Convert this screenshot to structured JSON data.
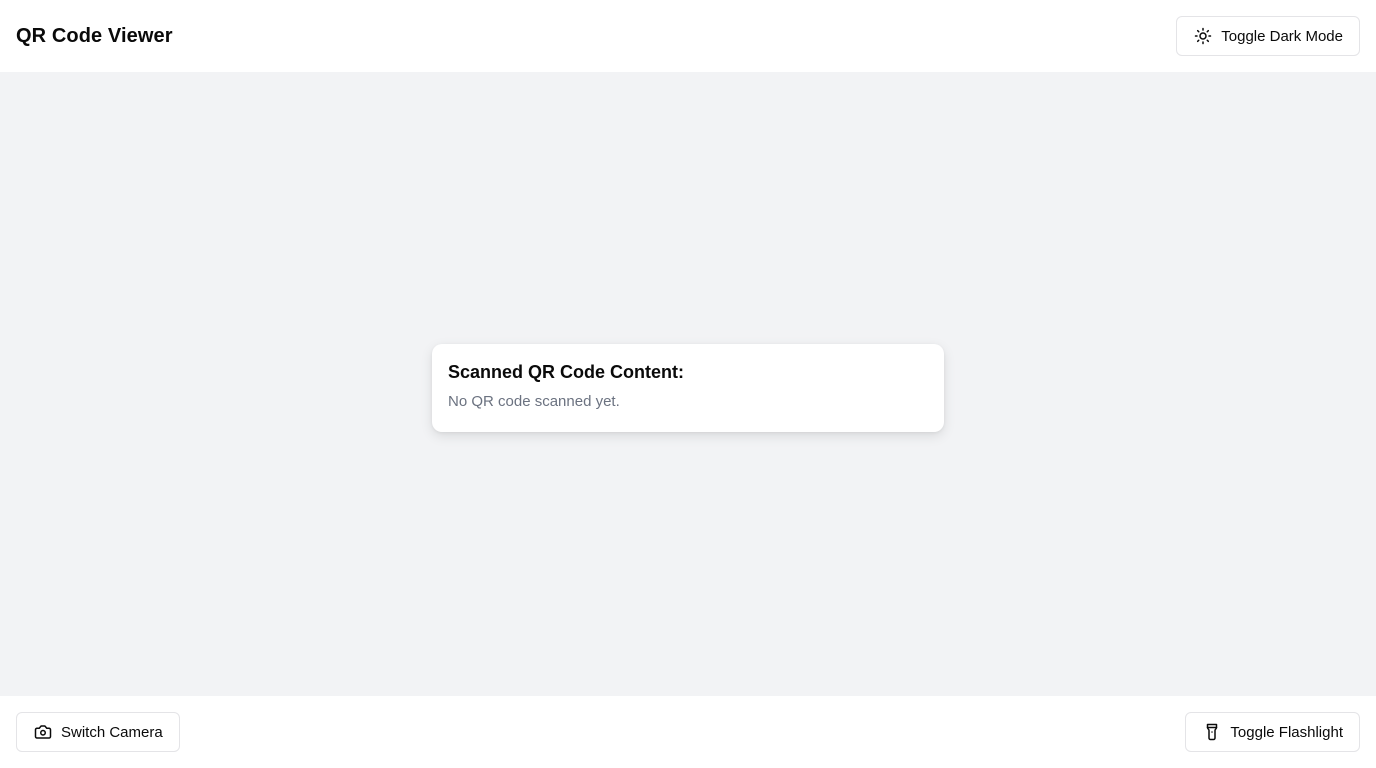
{
  "header": {
    "title": "QR Code Viewer",
    "dark_mode_button": {
      "label": "Toggle Dark Mode",
      "icon": "sun-icon"
    }
  },
  "main": {
    "card": {
      "title": "Scanned QR Code Content:",
      "content": "No QR code scanned yet."
    }
  },
  "footer": {
    "switch_camera_button": {
      "label": "Switch Camera",
      "icon": "camera-icon"
    },
    "flashlight_button": {
      "label": "Toggle Flashlight",
      "icon": "flashlight-icon"
    }
  },
  "colors": {
    "background": "#f2f3f5",
    "surface": "#ffffff",
    "border": "#e4e4e7",
    "muted_text": "#6b7280",
    "text": "#0a0a0a"
  }
}
